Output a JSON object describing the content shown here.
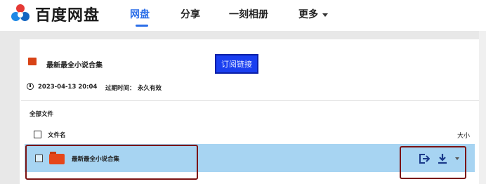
{
  "header": {
    "logo_text": "百度网盘",
    "nav": [
      {
        "label": "网盘",
        "active": true
      },
      {
        "label": "分享",
        "active": false
      },
      {
        "label": "一刻相册",
        "active": false
      },
      {
        "label": "更多",
        "active": false
      }
    ]
  },
  "share": {
    "title": "最新最全小说合集",
    "copy_button": "订阅链接",
    "date": "2023-04-13 20:04",
    "expire_label": "过期时间：",
    "expire_value": "永久有效"
  },
  "files": {
    "breadcrumb": "全部文件",
    "header_name": "文件名",
    "header_size": "大小",
    "rows": [
      {
        "name": "最新最全小说合集",
        "type": "folder"
      }
    ]
  },
  "colors": {
    "accent": "#2b6ee8",
    "row_selected": "#a7d4f2",
    "folder": "#e6461a",
    "highlight": "#7b1212",
    "button": "#1a3ff0"
  }
}
